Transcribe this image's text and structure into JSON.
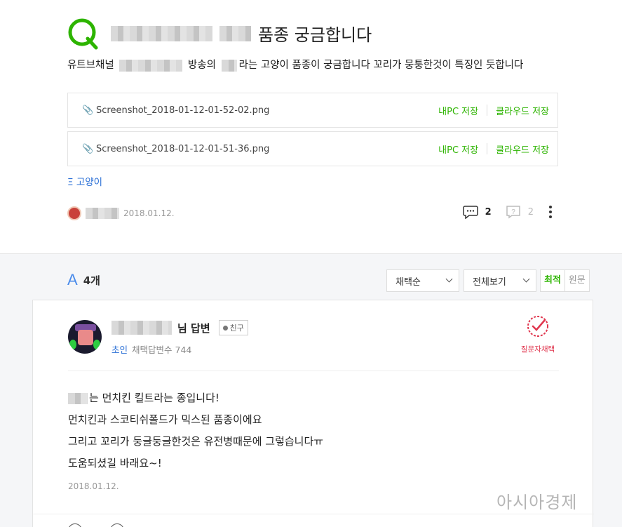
{
  "question": {
    "title_suffix": "품종 궁금합니다",
    "body_part1": "유트브채널",
    "body_part2": "방송의",
    "body_part3": "라는 고양이 품종이 궁금합니다 꼬리가 뭉퉁한것이 특징인 듯합니다",
    "attachments": [
      {
        "filename": "Screenshot_2018-01-12-01-52-02.png",
        "save_pc": "내PC 저장",
        "save_cloud": "클라우드 저장"
      },
      {
        "filename": "Screenshot_2018-01-12-01-51-36.png",
        "save_pc": "내PC 저장",
        "save_cloud": "클라우드 저장"
      }
    ],
    "tag": "Ξ 고양이",
    "date": "2018.01.12.",
    "comments": "2",
    "likes": "2",
    "colors": {
      "accent": "#2db400",
      "link": "#2a6fd6"
    }
  },
  "answers": {
    "count": "4개",
    "sort_select": "채택순",
    "view_select": "전체보기",
    "tab_latest": "최적",
    "tab_original": "원문",
    "list": [
      {
        "title": "님 답변",
        "friend_label": "친구",
        "level": "초인",
        "stats": "채택답변수 744",
        "choose_label": "질문자채택",
        "line1": "는 먼치킨 킬트라는 종입니다!",
        "line2": "먼치킨과 스코티쉬폴드가 믹스된 품종이에요",
        "line3": "그리고 꼬리가 둥글둥글한것은 유전병때문에 그렇습니다ㅠ",
        "line4": "도움되셨길 바래요~!",
        "date": "2018.01.12."
      }
    ]
  },
  "watermark": "아시아경제"
}
